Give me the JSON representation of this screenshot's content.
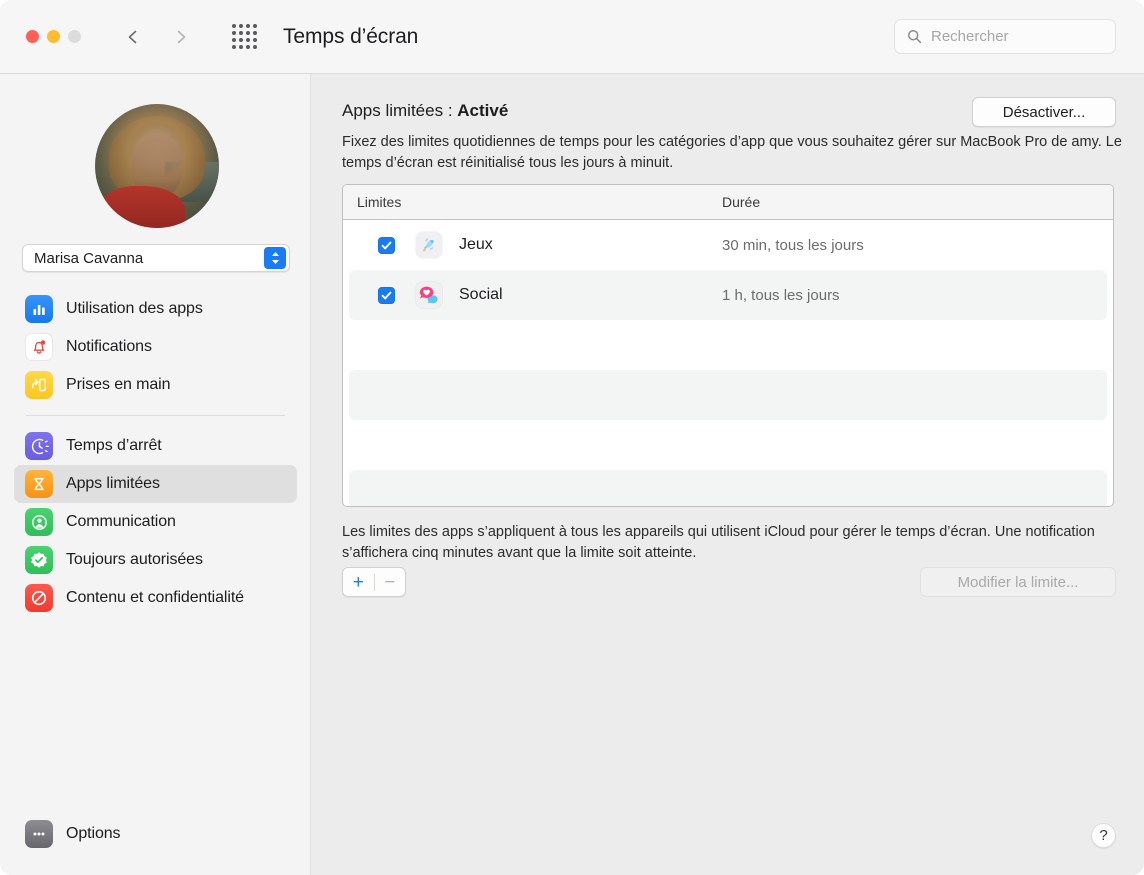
{
  "window": {
    "title": "Temps d’écran",
    "traffic_lights": [
      "close",
      "minimize",
      "zoom"
    ],
    "back_icon": "chevron-left-icon",
    "forward_icon": "chevron-right-icon",
    "grid_icon": "show-all-preferences-icon"
  },
  "search": {
    "placeholder": "Rechercher",
    "value": "",
    "icon": "search-icon"
  },
  "sidebar": {
    "avatar": "user-avatar-photo",
    "user_popup": {
      "value": "Marisa Cavanna",
      "icon": "chevron-up-down-icon"
    },
    "group_one": [
      {
        "label": "Utilisation des apps",
        "icon": "app-usage-icon"
      },
      {
        "label": "Notifications",
        "icon": "bell-icon"
      },
      {
        "label": "Prises en main",
        "icon": "pickups-icon"
      }
    ],
    "group_two": [
      {
        "label": "Temps d’arrêt",
        "icon": "downtime-icon"
      },
      {
        "label": "Apps limitées",
        "icon": "hourglass-icon",
        "selected": true
      },
      {
        "label": "Communication",
        "icon": "communication-icon"
      },
      {
        "label": "Toujours autorisées",
        "icon": "always-allowed-icon"
      },
      {
        "label": "Contenu et confidentialité",
        "icon": "content-privacy-icon"
      }
    ],
    "options": {
      "label": "Options",
      "icon": "ellipsis-icon"
    }
  },
  "main": {
    "status_prefix": "Apps limitées : ",
    "status_value": "Activé",
    "disable_button": "Désactiver...",
    "description": "Fixez des limites quotidiennes de temps pour les catégories d’app que vous souhaitez gérer sur MacBook Pro de amy. Le temps d’écran est réinitialisé tous les jours à minuit.",
    "table": {
      "columns": [
        "Limites",
        "Durée"
      ],
      "rows": [
        {
          "checked": true,
          "icon": "rocket-icon",
          "name": "Jeux",
          "duration": "30 min, tous les jours"
        },
        {
          "checked": true,
          "icon": "social-chat-icon",
          "name": "Social",
          "duration": "1 h, tous les jours"
        }
      ]
    },
    "footer_note": "Les limites des apps s’appliquent à tous les appareils qui utilisent iCloud pour gérer le temps d’écran. Une notification s’affichera cinq minutes avant que la limite soit atteinte.",
    "add_button": "+",
    "remove_button": "−",
    "edit_button": "Modifier la limite...",
    "help_button": "?"
  },
  "colors": {
    "accent_blue": "#1a7bf2",
    "window_bg": "#ececec",
    "sidebar_bg": "#f4f4f4",
    "selected_row": "#dfdfdf"
  }
}
